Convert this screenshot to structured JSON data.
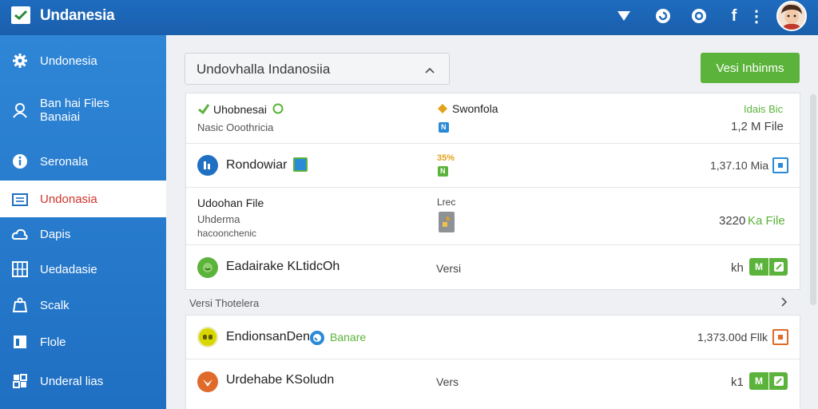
{
  "app": {
    "title": "Undanesia"
  },
  "sidebar": {
    "items": [
      {
        "label": "Undonesia",
        "icon": "gear-icon"
      },
      {
        "label": "Ban hai Files\nBanaiai",
        "icon": "user-icon"
      },
      {
        "label": "Seronala",
        "icon": "info-icon"
      },
      {
        "label": "Undonasia",
        "icon": "folder-icon",
        "active": true
      },
      {
        "label": "Dapis",
        "icon": "cloud-icon"
      },
      {
        "label": "Uedadasie",
        "icon": "grid-icon"
      },
      {
        "label": "Scalk",
        "icon": "scale-icon"
      },
      {
        "label": "Flole",
        "icon": "file-icon"
      },
      {
        "label": "Underal lias",
        "icon": "settings-icon"
      }
    ]
  },
  "search": {
    "value": "Undovhalla Indanosiia"
  },
  "primary_button": "Vesi Inbinms",
  "rows": [
    {
      "title": "Uhobnesai",
      "subtitle": "Nasic Ooothricia",
      "mid_title": "Swonfola",
      "mid_badge": "N",
      "right_top": "Idais Bic",
      "right": "1,2 M File"
    },
    {
      "title": "Rondowiar",
      "mid_percent": "35%",
      "mid_badge": "N",
      "right": "1,37.10 Mia"
    },
    {
      "title": "Udoohan File",
      "subtitle": "Uhderma",
      "subtitle2": "hacoonchenic",
      "mid_title": "Lrec",
      "right_value": "3220",
      "right_label": "Ka File"
    },
    {
      "title": "Eadairake KLtidcOh",
      "mid_title": "Versi",
      "right": "kh",
      "pill_label": "M"
    }
  ],
  "section": {
    "label": "Versi Thotelera"
  },
  "rows2": [
    {
      "title": "EndionsanDen",
      "tag": "Banare",
      "right": "1,373.00d Fllk"
    },
    {
      "title": "Urdehabe KSoludn",
      "mid_title": "Vers",
      "right": "k1",
      "pill_label": "M"
    }
  ],
  "colors": {
    "topbar": "#1e6bbf",
    "sidebar": "#2a7fd0",
    "accent_green": "#5bb33b",
    "active_text": "#d0342c"
  }
}
